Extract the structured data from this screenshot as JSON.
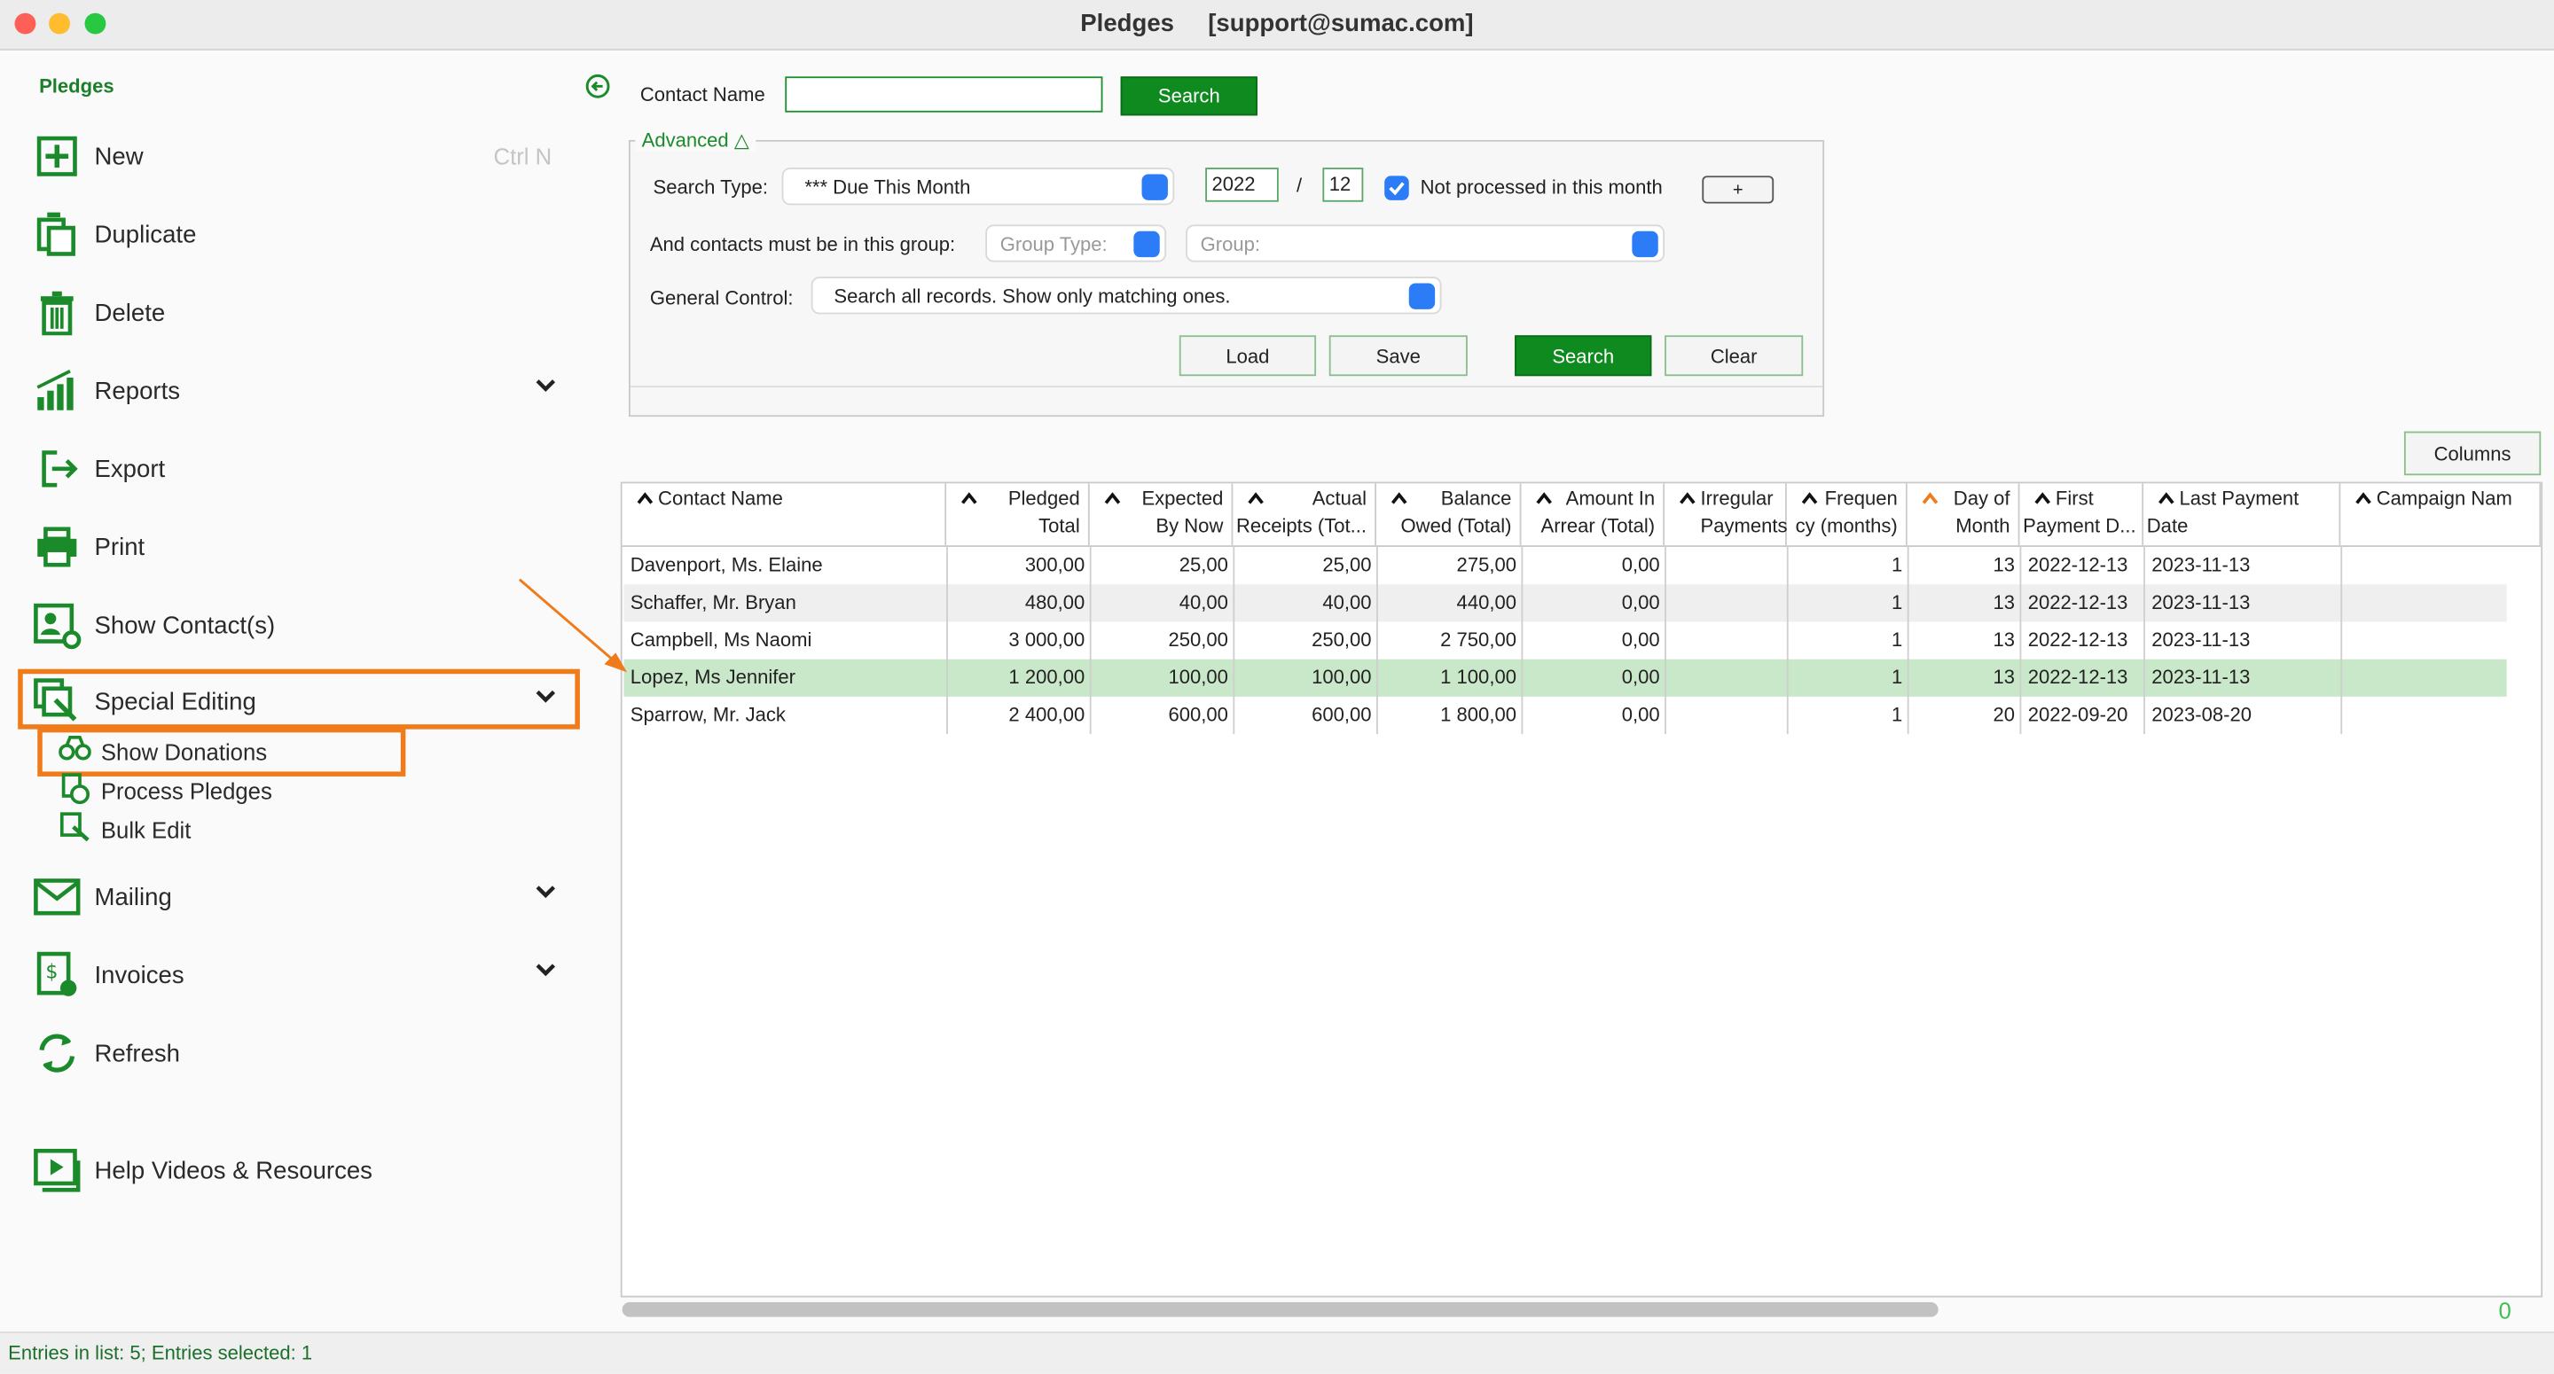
{
  "window": {
    "title": "Pledges",
    "account": "[support@sumac.com]"
  },
  "sidebar": {
    "heading": "Pledges",
    "new_label": "New",
    "new_shortcut": "Ctrl N",
    "duplicate_label": "Duplicate",
    "delete_label": "Delete",
    "reports_label": "Reports",
    "export_label": "Export",
    "print_label": "Print",
    "show_contacts_label": "Show Contact(s)",
    "special_editing_label": "Special Editing",
    "show_donations_label": "Show Donations",
    "process_pledges_label": "Process Pledges",
    "bulk_edit_label": "Bulk Edit",
    "mailing_label": "Mailing",
    "invoices_label": "Invoices",
    "refresh_label": "Refresh",
    "help_label": "Help Videos & Resources"
  },
  "search": {
    "contact_name_label": "Contact Name",
    "contact_name_value": "",
    "search_button": "Search",
    "advanced_label": "Advanced △",
    "search_type_label": "Search Type:",
    "search_type_value": "*** Due This Month",
    "year_value": "2022",
    "slash": "/",
    "month_value": "12",
    "not_processed_label": "Not processed in this month",
    "plus_button": "+",
    "group_label": "And contacts must be in this group:",
    "group_type_placeholder": "Group Type:",
    "group_placeholder": "Group:",
    "general_control_label": "General Control:",
    "general_control_value": "Search all records. Show only matching ones.",
    "load_button": "Load",
    "save_button": "Save",
    "search_button2": "Search",
    "clear_button": "Clear"
  },
  "columns_button": "Columns",
  "table": {
    "headers": [
      {
        "l1": "Contact Name",
        "l2": ""
      },
      {
        "l1": "Pledged",
        "l2": "Total"
      },
      {
        "l1": "Expected",
        "l2": "By Now"
      },
      {
        "l1": "Actual",
        "l2": "Receipts (Tot..."
      },
      {
        "l1": "Balance",
        "l2": "Owed (Total)"
      },
      {
        "l1": "Amount In",
        "l2": "Arrear (Total)"
      },
      {
        "l1": "Irregular",
        "l2": "Payments"
      },
      {
        "l1": "Frequen",
        "l2": "cy (months)"
      },
      {
        "l1": "Day of",
        "l2": "Month"
      },
      {
        "l1": "First",
        "l2": "Payment D..."
      },
      {
        "l1": "Last Payment",
        "l2": "Date"
      },
      {
        "l1": "Campaign Nam",
        "l2": ""
      }
    ],
    "rows": [
      [
        "Davenport, Ms. Elaine",
        "300,00",
        "25,00",
        "25,00",
        "275,00",
        "0,00",
        "",
        "1",
        "13",
        "2022-12-13",
        "2023-11-13",
        ""
      ],
      [
        "Schaffer, Mr. Bryan",
        "480,00",
        "40,00",
        "40,00",
        "440,00",
        "0,00",
        "",
        "1",
        "13",
        "2022-12-13",
        "2023-11-13",
        ""
      ],
      [
        "Campbell, Ms Naomi",
        "3 000,00",
        "250,00",
        "250,00",
        "2 750,00",
        "0,00",
        "",
        "1",
        "13",
        "2022-12-13",
        "2023-11-13",
        ""
      ],
      [
        "Lopez, Ms Jennifer",
        "1 200,00",
        "100,00",
        "100,00",
        "1 100,00",
        "0,00",
        "",
        "1",
        "13",
        "2022-12-13",
        "2023-11-13",
        ""
      ],
      [
        "Sparrow, Mr. Jack",
        "2 400,00",
        "600,00",
        "600,00",
        "1 800,00",
        "0,00",
        "",
        "1",
        "20",
        "2022-09-20",
        "2023-08-20",
        ""
      ]
    ],
    "selected_row": 3,
    "scroll_indicator": "0"
  },
  "status": {
    "text": "Entries in list: 5; Entries selected: 1"
  },
  "colors": {
    "accent": "#0e8a1f",
    "highlight": "#f07b1a",
    "selected_row": "#c9e8c9"
  }
}
